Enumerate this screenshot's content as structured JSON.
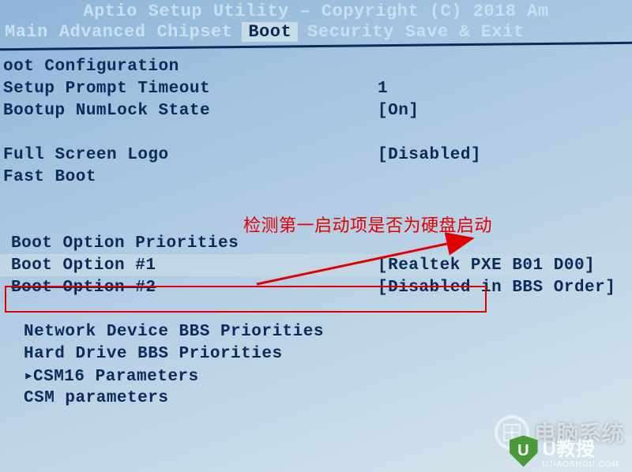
{
  "title": "Aptio Setup Utility – Copyright (C) 2018 Am",
  "menu": {
    "items": [
      "Main",
      "Advanced",
      "Chipset",
      "Boot",
      "Security",
      "Save & Exit"
    ],
    "active_index": 3
  },
  "section": {
    "header": "oot Configuration",
    "setup_prompt_label": "Setup Prompt Timeout",
    "setup_prompt_value": "1",
    "numlock_label": "Bootup NumLock State",
    "numlock_value": "[On]",
    "fslogo_label": "Full Screen Logo",
    "fslogo_value": "[Disabled]",
    "fastboot_label": "Fast Boot",
    "fastboot_value": ""
  },
  "boot_priorities": {
    "header": "Boot Option Priorities",
    "opt1_label": "Boot Option #1",
    "opt1_value": "[Realtek PXE B01 D00]",
    "opt2_label": "Boot Option #2",
    "opt2_value": "[Disabled in BBS Order]"
  },
  "submenus": {
    "net_bbs": "Network Device BBS Priorities",
    "hd_bbs": "Hard Drive BBS Priorities",
    "csm16": "CSM16 Parameters",
    "csm": "CSM parameters"
  },
  "annotation": {
    "text": "检测第一启动项是否为硬盘启动"
  },
  "watermarks": {
    "w1": "电脑系统",
    "w2": "U教授",
    "w2_sub": "UJIAOSHOU.COM"
  }
}
